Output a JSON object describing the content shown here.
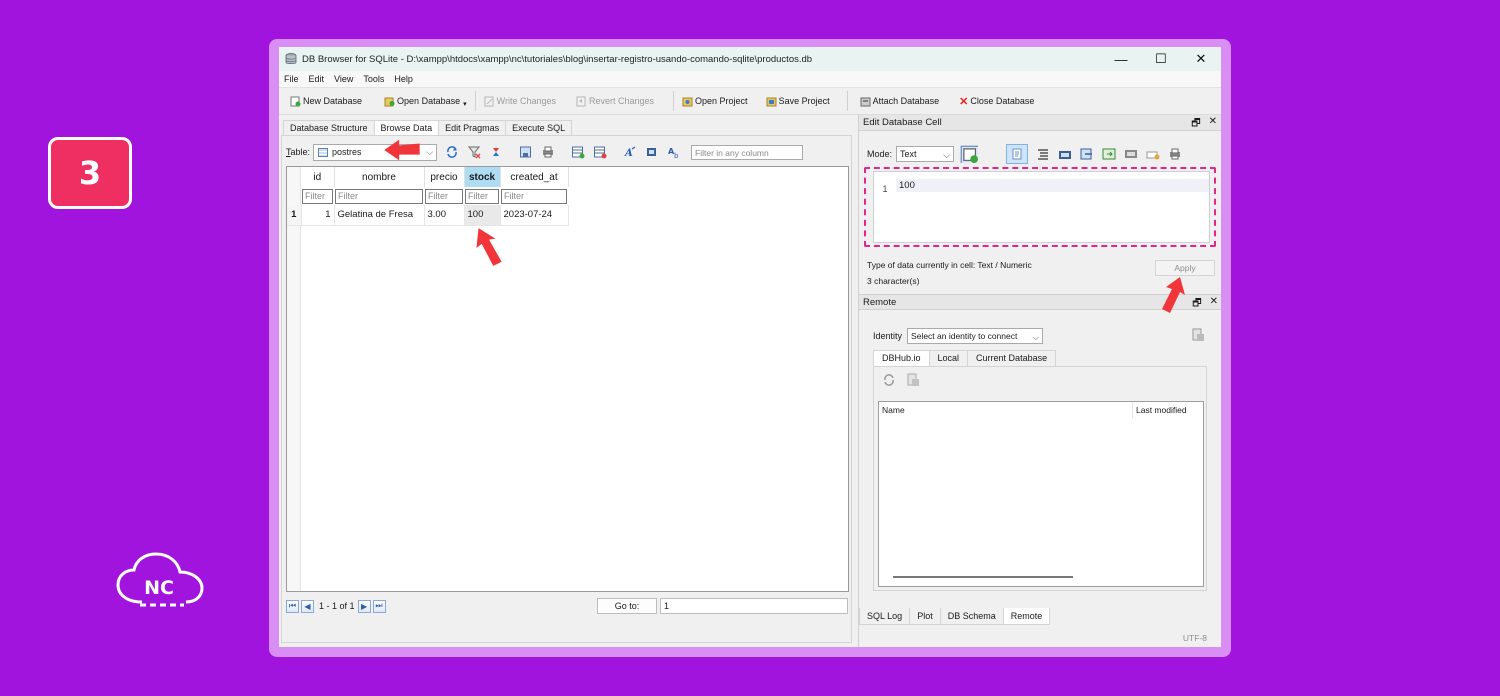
{
  "step_badge": "3",
  "brand_logo_text": "NC",
  "window": {
    "title": "DB Browser for SQLite - D:\\xampp\\htdocs\\xampp\\nc\\tutoriales\\blog\\insertar-registro-usando-comando-sqlite\\productos.db",
    "controls": {
      "minimize": "—",
      "maximize": "☐",
      "close": "✕"
    }
  },
  "menu": [
    "File",
    "Edit",
    "View",
    "Tools",
    "Help"
  ],
  "toolbar": {
    "new_db": "New Database",
    "open_db": "Open Database",
    "write_changes": "Write Changes",
    "revert_changes": "Revert Changes",
    "open_project": "Open Project",
    "save_project": "Save Project",
    "attach_db": "Attach Database",
    "close_db": "Close Database"
  },
  "tabs": [
    "Database Structure",
    "Browse Data",
    "Edit Pragmas",
    "Execute SQL"
  ],
  "browse": {
    "table_label_u": "T",
    "table_label_rest": "able:",
    "table_value": "postres",
    "filter_any_placeholder": "Filter in any column",
    "filter_placeholder": "Filter",
    "columns": [
      "id",
      "nombre",
      "precio",
      "stock",
      "created_at"
    ],
    "selected_column": "stock",
    "rows": [
      {
        "rownum": "1",
        "id": "1",
        "nombre": "Gelatina de Fresa",
        "precio": "3.00",
        "stock": "100",
        "created_at": "2023-07-24"
      }
    ],
    "nav_text": "1 - 1 of 1",
    "goto_label": "Go to:",
    "goto_value": "1"
  },
  "edit_cell": {
    "title": "Edit Database Cell",
    "mode_label": "Mode:",
    "mode_value": "Text",
    "line_number": "1",
    "content": "100",
    "type_info": "Type of data currently in cell: Text / Numeric",
    "char_count": "3 character(s)",
    "apply": "Apply"
  },
  "remote": {
    "title": "Remote",
    "identity_label": "Identity",
    "identity_value": "Select an identity to connect",
    "tabs": [
      "DBHub.io",
      "Local",
      "Current Database"
    ],
    "col_name": "Name",
    "col_modified": "Last modified"
  },
  "bottom_tabs": [
    "SQL Log",
    "Plot",
    "DB Schema",
    "Remote"
  ],
  "status": "UTF-8",
  "dock_buttons": {
    "float": "🗗",
    "close": "✕"
  },
  "colors": {
    "background": "#a114de",
    "badge": "#ef2f62",
    "arrow": "#f0363a",
    "highlight_dash": "#e0278a",
    "selected_header": "#aedcf3"
  }
}
